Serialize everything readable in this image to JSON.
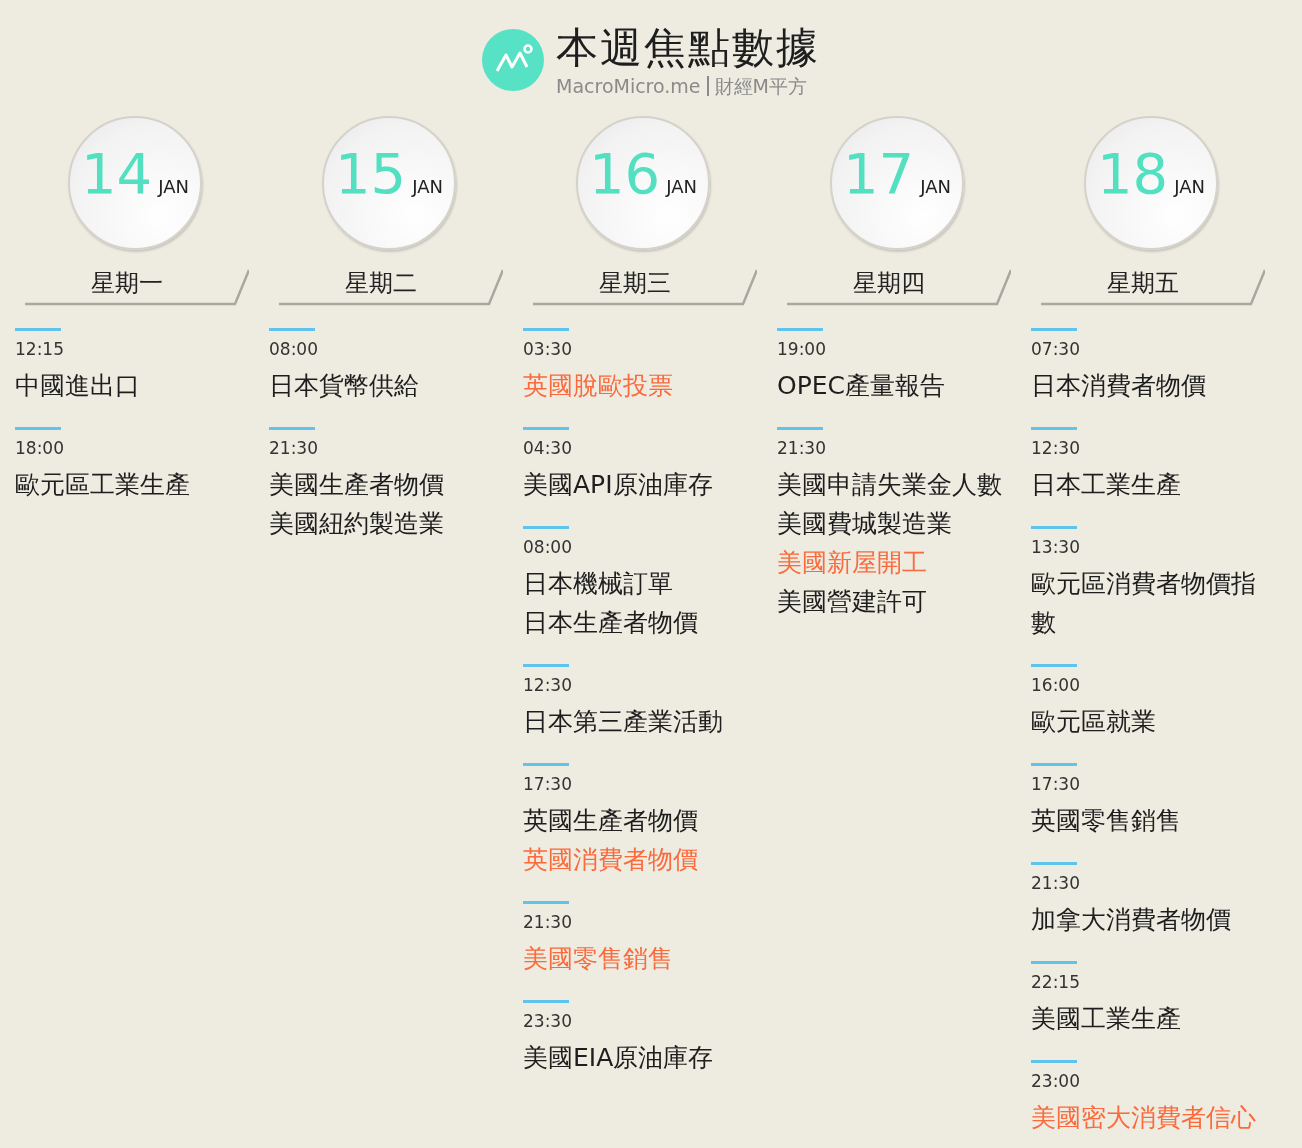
{
  "header": {
    "title": "本週焦點數據",
    "brand": "MacroMicro.me",
    "brand_cn": "財經M平方"
  },
  "days": [
    {
      "date": "14",
      "month": "JAN",
      "weekday": "星期一",
      "groups": [
        {
          "time": "12:15",
          "events": [
            {
              "name": "中國進出口",
              "highlight": false
            }
          ]
        },
        {
          "time": "18:00",
          "events": [
            {
              "name": "歐元區工業生產",
              "highlight": false
            }
          ]
        }
      ]
    },
    {
      "date": "15",
      "month": "JAN",
      "weekday": "星期二",
      "groups": [
        {
          "time": "08:00",
          "events": [
            {
              "name": "日本貨幣供給",
              "highlight": false
            }
          ]
        },
        {
          "time": "21:30",
          "events": [
            {
              "name": "美國生產者物價",
              "highlight": false
            },
            {
              "name": "美國紐約製造業",
              "highlight": false
            }
          ]
        }
      ]
    },
    {
      "date": "16",
      "month": "JAN",
      "weekday": "星期三",
      "groups": [
        {
          "time": "03:30",
          "events": [
            {
              "name": "英國脫歐投票",
              "highlight": true
            }
          ]
        },
        {
          "time": "04:30",
          "events": [
            {
              "name": "美國API原油庫存",
              "highlight": false
            }
          ]
        },
        {
          "time": "08:00",
          "events": [
            {
              "name": "日本機械訂單",
              "highlight": false
            },
            {
              "name": "日本生產者物價",
              "highlight": false
            }
          ]
        },
        {
          "time": "12:30",
          "events": [
            {
              "name": "日本第三產業活動",
              "highlight": false
            }
          ]
        },
        {
          "time": "17:30",
          "events": [
            {
              "name": "英國生產者物價",
              "highlight": false
            },
            {
              "name": "英國消費者物價",
              "highlight": true
            }
          ]
        },
        {
          "time": "21:30",
          "events": [
            {
              "name": "美國零售銷售",
              "highlight": true
            }
          ]
        },
        {
          "time": "23:30",
          "events": [
            {
              "name": "美國EIA原油庫存",
              "highlight": false
            }
          ]
        }
      ]
    },
    {
      "date": "17",
      "month": "JAN",
      "weekday": "星期四",
      "groups": [
        {
          "time": "19:00",
          "events": [
            {
              "name": "OPEC產量報告",
              "highlight": false
            }
          ]
        },
        {
          "time": "21:30",
          "events": [
            {
              "name": "美國申請失業金人數",
              "highlight": false
            },
            {
              "name": "美國費城製造業",
              "highlight": false
            },
            {
              "name": "美國新屋開工",
              "highlight": true
            },
            {
              "name": "美國營建許可",
              "highlight": false
            }
          ]
        }
      ]
    },
    {
      "date": "18",
      "month": "JAN",
      "weekday": "星期五",
      "groups": [
        {
          "time": "07:30",
          "events": [
            {
              "name": "日本消費者物價",
              "highlight": false
            }
          ]
        },
        {
          "time": "12:30",
          "events": [
            {
              "name": "日本工業生產",
              "highlight": false
            }
          ]
        },
        {
          "time": "13:30",
          "events": [
            {
              "name": "歐元區消費者物價指數",
              "highlight": false
            }
          ]
        },
        {
          "time": "16:00",
          "events": [
            {
              "name": "歐元區就業",
              "highlight": false
            }
          ]
        },
        {
          "time": "17:30",
          "events": [
            {
              "name": "英國零售銷售",
              "highlight": false
            }
          ]
        },
        {
          "time": "21:30",
          "events": [
            {
              "name": "加拿大消費者物價",
              "highlight": false
            }
          ]
        },
        {
          "time": "22:15",
          "events": [
            {
              "name": "美國工業生產",
              "highlight": false
            }
          ]
        },
        {
          "time": "23:00",
          "events": [
            {
              "name": "美國密大消費者信心",
              "highlight": true
            }
          ]
        }
      ]
    }
  ]
}
